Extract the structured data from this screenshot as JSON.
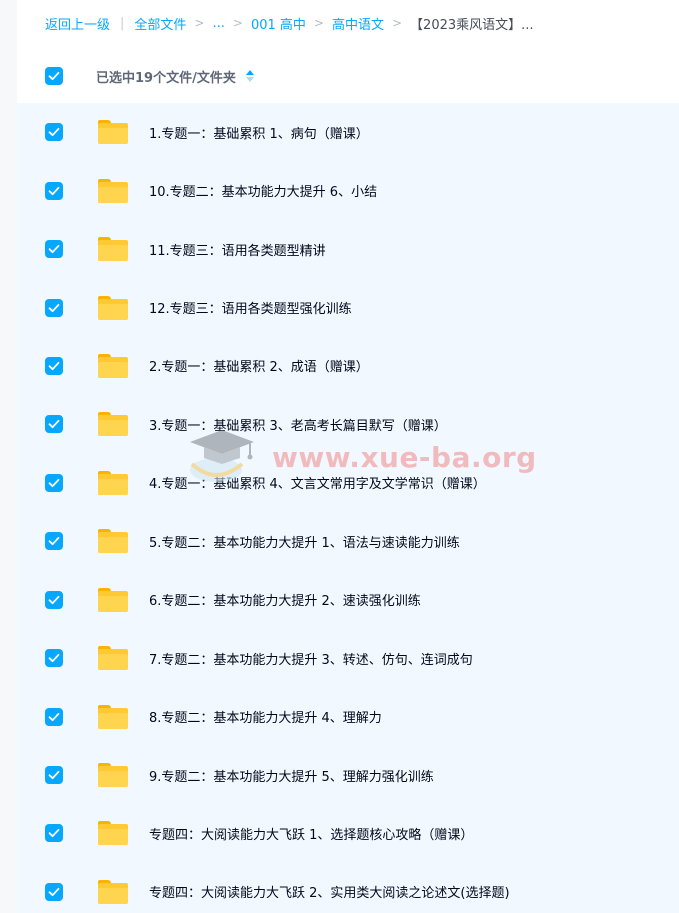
{
  "breadcrumb": {
    "back": "返回上一级",
    "all_files": "全部文件",
    "ellipsis": "...",
    "crumb1": "001 高中",
    "crumb2": "高中语文",
    "current": "【2023乘风语文】..."
  },
  "selection": {
    "label": "已选中19个文件/文件夹"
  },
  "files": [
    {
      "name": "1.专题一：基础累积 1、病句（赠课）"
    },
    {
      "name": "10.专题二：基本功能力大提升 6、小结"
    },
    {
      "name": "11.专题三：语用各类题型精讲"
    },
    {
      "name": "12.专题三：语用各类题型强化训练"
    },
    {
      "name": "2.专题一：基础累积 2、成语（赠课）"
    },
    {
      "name": "3.专题一：基础累积 3、老高考长篇目默写（赠课）"
    },
    {
      "name": "4.专题一：基础累积 4、文言文常用字及文学常识（赠课）"
    },
    {
      "name": "5.专题二：基本功能力大提升 1、语法与速读能力训练"
    },
    {
      "name": "6.专题二：基本功能力大提升 2、速读强化训练"
    },
    {
      "name": "7.专题二：基本功能力大提升 3、转述、仿句、连词成句"
    },
    {
      "name": "8.专题二：基本功能力大提升 4、理解力"
    },
    {
      "name": "9.专题二：基本功能力大提升 5、理解力强化训练"
    },
    {
      "name": "专题四：大阅读能力大飞跃 1、选择题核心攻略（赠课）"
    },
    {
      "name": "专题四：大阅读能力大飞跃 2、实用类大阅读之论述文(选择题)"
    }
  ],
  "watermark": {
    "text": "www.xue-ba.org"
  },
  "colors": {
    "accent": "#06a7ff",
    "row_bg": "#f1f8ff",
    "folder": "#ffc933",
    "text": "#03081a"
  }
}
